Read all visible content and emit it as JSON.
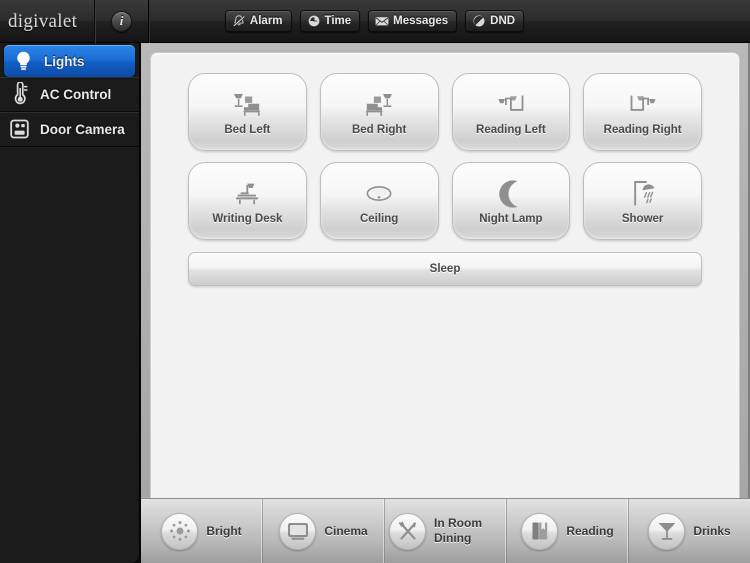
{
  "app": {
    "brand": "digivalet",
    "info_label": "i"
  },
  "topbar": {
    "buttons": [
      {
        "label": "Alarm",
        "icon": "alarm-off-icon"
      },
      {
        "label": "Time",
        "icon": "clock-icon"
      },
      {
        "label": "Messages",
        "icon": "envelope-icon"
      },
      {
        "label": "DND",
        "icon": "do-not-disturb-icon"
      }
    ]
  },
  "sidebar": {
    "items": [
      {
        "label": "Lights",
        "icon": "lightbulb-icon",
        "selected": true
      },
      {
        "label": "AC Control",
        "icon": "thermometer-icon",
        "selected": false
      },
      {
        "label": "Door Camera",
        "icon": "camera-icon",
        "selected": false
      }
    ]
  },
  "main": {
    "lights": [
      {
        "label": "Bed Left",
        "icon": "bed-lamp-left-icon"
      },
      {
        "label": "Bed Right",
        "icon": "bed-lamp-right-icon"
      },
      {
        "label": "Reading Left",
        "icon": "reading-lamp-left-icon"
      },
      {
        "label": "Reading Right",
        "icon": "reading-lamp-right-icon"
      },
      {
        "label": "Writing Desk",
        "icon": "desk-lamp-icon"
      },
      {
        "label": "Ceiling",
        "icon": "ceiling-light-icon"
      },
      {
        "label": "Night Lamp",
        "icon": "crescent-moon-icon"
      },
      {
        "label": "Shower",
        "icon": "showerhead-icon"
      }
    ],
    "sleep_label": "Sleep"
  },
  "dock": {
    "items": [
      {
        "label": "Bright",
        "icon": "brightness-sun-icon"
      },
      {
        "label": "Cinema",
        "icon": "television-icon"
      },
      {
        "label": "In Room Dining",
        "icon": "fork-knife-icon"
      },
      {
        "label": "Reading",
        "icon": "book-icon"
      },
      {
        "label": "Drinks",
        "icon": "martini-glass-icon"
      }
    ]
  },
  "colors": {
    "accent_blue": "#1b6fd6",
    "sidebar_bg": "#1b1b1b",
    "panel_bg": "#f2f2f2",
    "icon_gray": "#8a8a8a"
  }
}
